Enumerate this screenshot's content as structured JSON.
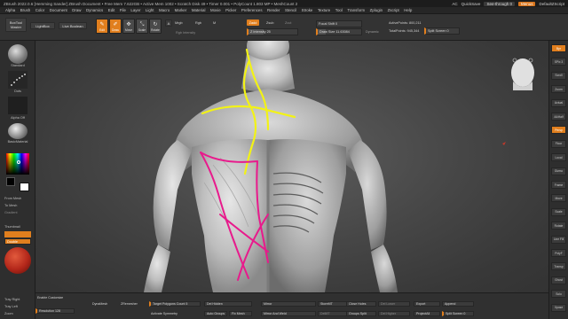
{
  "titlebar": {
    "text": "ZBrush 2022.0.6 [Hemming Sander]   ZBrush Document   • Free Mem 7.622GB • Active Mem 1002 • Scratch Disk 49 • Timer 0.001 • PolyCount 1.803 MP • MeshCount 2",
    "ac": "AC",
    "quicksave": "QuickSave",
    "seethrough": "See-through  0",
    "menus": "Menus",
    "defaultzscript": "DefaultZScript"
  },
  "menubar": [
    "Alpha",
    "Brush",
    "Color",
    "Document",
    "Draw",
    "Dynamics",
    "Edit",
    "File",
    "Layer",
    "Light",
    "Macro",
    "Marker",
    "Material",
    "Movie",
    "Picker",
    "Preferences",
    "Render",
    "Stencil",
    "Stroke",
    "Texture",
    "Tool",
    "Transform",
    "Zplugin",
    "Zscript",
    "Help"
  ],
  "shelf": {
    "boxtool": "BoxTool Master",
    "lightbox": "LightBox",
    "livebool": "Live Boolean",
    "modes": [
      {
        "label": "Edit",
        "icon": "✎",
        "active": true
      },
      {
        "label": "Draw",
        "icon": "✐",
        "active": true
      },
      {
        "label": "Move",
        "icon": "✥",
        "active": false
      },
      {
        "label": "Scale",
        "icon": "⤡",
        "active": false
      },
      {
        "label": "Rotate",
        "icon": "↻",
        "active": false
      }
    ],
    "a": "A",
    "mrgb": "Mrgb",
    "rgb": "Rgb",
    "m": "M",
    "rgb_intensity": "Rgb Intensity",
    "zadd": "Zadd",
    "zsub": "Zsub",
    "zcut": "Zcut",
    "z_intensity": "Z Intensity 25",
    "focal_shift": "Focal Shift 0",
    "draw_size": "Draw Size 11.63084",
    "dynamic": "Dynamic",
    "active_points": "ActivePoints: 800,211",
    "total_points": "TotalPoints: 945,344",
    "split_screen": "Split Screen 0"
  },
  "lefttray": {
    "brush": "Standard",
    "stroke": "Dots",
    "alpha": "Alpha Off",
    "material": "BasicMaterial",
    "from_mesh": "From Mesh",
    "to_mesh": "To Mesh",
    "gradient": "Gradient",
    "thumbnail": "Thumbnail",
    "double": "Double",
    "tray_right": "Tray Right",
    "tray_left": "Tray Left",
    "zoom": "Zoom",
    "s": "S"
  },
  "righttray": [
    "Bpr",
    "SPix 3",
    "Scroll",
    "Zoom",
    "Actual",
    "AAHalf",
    "Persp",
    "Floor",
    "Local",
    "Gizmo",
    "Frame",
    "Move",
    "Scale",
    "Rotate",
    "Line Fill",
    "PolyF",
    "Transp",
    "Ghost",
    "Solo",
    "Xpose"
  ],
  "bottom": {
    "enable_customize": "Enable Customize",
    "resolution": "Resolution 128",
    "dynamesh": "DynaMesh",
    "zremesher": "ZRemesher",
    "target_polygons": "Target Polygons Count 5",
    "activate_symmetry": "Activate Symmetry",
    "del_hidden": "Del Hidden",
    "auto_groups": "Auto Groups",
    "fix_mesh": "Fix Mesh",
    "mirror": "Mirror",
    "mirror_and_weld": "Mirror And Weld",
    "storemt": "StoreMT",
    "delmt": "DelMT",
    "close_holes": "Close Holes",
    "groups_split": "Groups Split",
    "del_lower": "Del Lower",
    "del_higher": "Del Higher",
    "export": "Export",
    "projectall": "ProjectAll",
    "append": "Append",
    "split_screen": "Split Screen 0"
  },
  "colors": {
    "accent": "#e17f1e",
    "annotation_yellow": "#f2f216",
    "annotation_magenta": "#e81a8c"
  }
}
